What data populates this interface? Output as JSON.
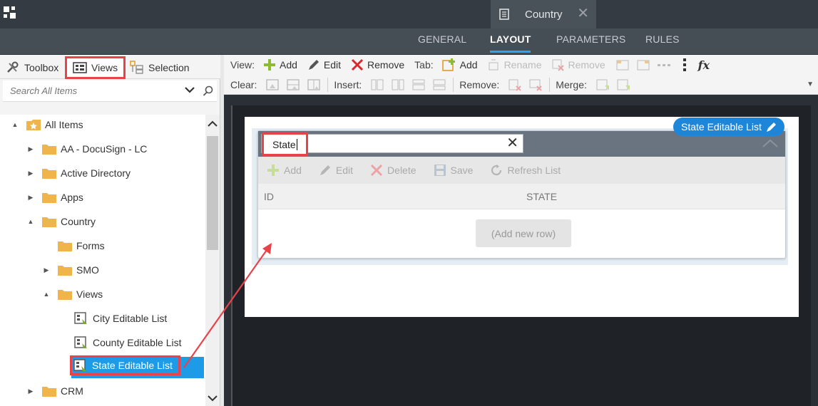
{
  "topbar": {
    "app_icon": "app-grid-icon",
    "document_tab": {
      "title": "Country",
      "icon": "document-icon",
      "close_icon": "close-icon"
    }
  },
  "nav": {
    "tabs": [
      {
        "label": "GENERAL",
        "active": false
      },
      {
        "label": "LAYOUT",
        "active": true
      },
      {
        "label": "PARAMETERS",
        "active": false
      },
      {
        "label": "RULES",
        "active": false
      }
    ]
  },
  "left_panel": {
    "tabs": [
      {
        "label": "Toolbox",
        "icon": "wrench-icon"
      },
      {
        "label": "Views",
        "icon": "views-icon"
      },
      {
        "label": "Selection",
        "icon": "selection-icon"
      }
    ],
    "search": {
      "placeholder": "Search All Items"
    },
    "tree": [
      {
        "label": "All Items",
        "expander": "▲"
      },
      {
        "label": "AA - DocuSign - LC",
        "expander": "▶"
      },
      {
        "label": "Active Directory",
        "expander": "▶"
      },
      {
        "label": "Apps",
        "expander": "▶"
      },
      {
        "label": "Country",
        "expander": "▲"
      },
      {
        "label": "Forms",
        "expander": ""
      },
      {
        "label": "SMO",
        "expander": "▶"
      },
      {
        "label": "Views",
        "expander": "▲"
      },
      {
        "label": "City Editable List",
        "expander": ""
      },
      {
        "label": "County Editable List",
        "expander": ""
      },
      {
        "label": "State Editable List",
        "expander": "",
        "selected": true
      },
      {
        "label": "CRM",
        "expander": "▶"
      }
    ]
  },
  "toolbar": {
    "row1": {
      "view_label": "View:",
      "add": "Add",
      "edit": "Edit",
      "remove": "Remove",
      "tab_label": "Tab:",
      "tab_add": "Add",
      "rename": "Rename",
      "tab_remove": "Remove",
      "fx": "fx"
    },
    "row2": {
      "clear_label": "Clear:",
      "insert_label": "Insert:",
      "remove_label": "Remove:",
      "merge_label": "Merge:"
    }
  },
  "canvas": {
    "view_badge": "State Editable List",
    "view_title_value": "State",
    "view_toolbar": {
      "add": "Add",
      "edit": "Edit",
      "delete": "Delete",
      "save": "Save",
      "refresh": "Refresh List"
    },
    "columns": {
      "id": "ID",
      "state": "STATE"
    },
    "add_new_row": "(Add new row)"
  },
  "colors": {
    "accent_blue": "#1e9be6",
    "highlight_red": "#e8434a",
    "active_underline": "#2ea3f2"
  }
}
